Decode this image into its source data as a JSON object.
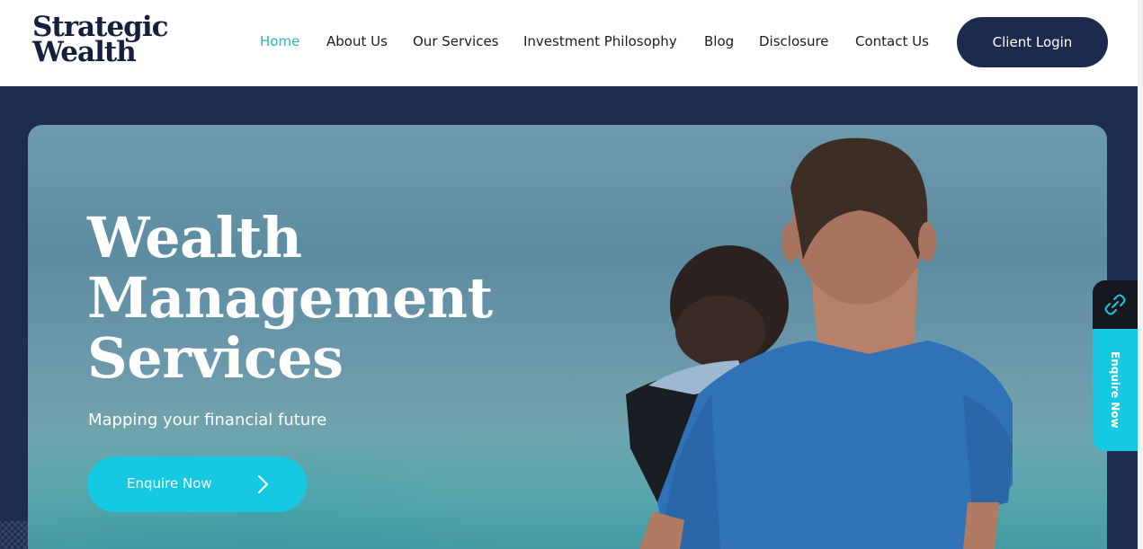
{
  "brand": {
    "line1": "Strategic",
    "line2": "Wealth"
  },
  "nav": [
    {
      "label": "Home",
      "active": true
    },
    {
      "label": "About Us",
      "active": false
    },
    {
      "label": "Our Services",
      "active": false
    },
    {
      "label": "Investment Philosophy",
      "active": false
    },
    {
      "label": "Blog",
      "active": false
    },
    {
      "label": "Disclosure",
      "active": false
    },
    {
      "label": "Contact Us",
      "active": false
    }
  ],
  "header": {
    "login_label": "Client Login"
  },
  "hero": {
    "title_lines": [
      "Wealth",
      "Management",
      "Services"
    ],
    "subtitle": "Mapping your financial future",
    "cta_label": "Enquire Now",
    "cta_icon": "chevron-right-icon"
  },
  "side_tab": {
    "icon": "link-icon",
    "label": "Enquire Now"
  },
  "colors": {
    "navy": "#1c2a4e",
    "accent_cyan": "#16c9e2",
    "nav_active": "#22b8cc"
  }
}
